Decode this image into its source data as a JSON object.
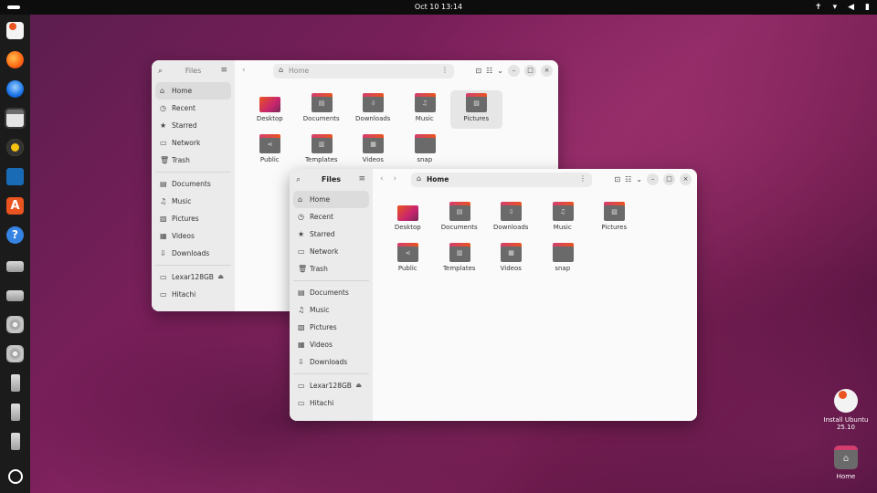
{
  "topbar": {
    "clock": "Oct 10  13:14",
    "status_icons": [
      "accessibility-icon",
      "network-icon",
      "volume-icon",
      "battery-icon"
    ]
  },
  "dock": {
    "items": [
      {
        "name": "installer",
        "icon": "ubuntu-installer-icon"
      },
      {
        "name": "firefox",
        "icon": "firefox-icon"
      },
      {
        "name": "thunderbird",
        "icon": "thunderbird-icon"
      },
      {
        "name": "files",
        "icon": "files-icon",
        "active": true
      },
      {
        "name": "rhythmbox",
        "icon": "rhythmbox-icon"
      },
      {
        "name": "writer",
        "icon": "libreoffice-writer-icon"
      },
      {
        "name": "app-center",
        "icon": "app-center-icon"
      },
      {
        "name": "help",
        "icon": "help-icon"
      },
      {
        "name": "drive-1",
        "icon": "drive-icon"
      },
      {
        "name": "drive-2",
        "icon": "drive-icon"
      },
      {
        "name": "disc-1",
        "icon": "disc-icon"
      },
      {
        "name": "disc-2",
        "icon": "disc-icon"
      },
      {
        "name": "usb-1",
        "icon": "usb-icon"
      },
      {
        "name": "usb-2",
        "icon": "usb-icon"
      },
      {
        "name": "usb-3",
        "icon": "usb-icon"
      },
      {
        "name": "show-apps",
        "icon": "ubuntu-logo-icon"
      }
    ]
  },
  "files_window": {
    "title": "Files",
    "path_label": "Home",
    "sidebar": {
      "places": [
        {
          "label": "Home",
          "icon": "⌂"
        },
        {
          "label": "Recent",
          "icon": "◷"
        },
        {
          "label": "Starred",
          "icon": "★"
        },
        {
          "label": "Network",
          "icon": "▭"
        },
        {
          "label": "Trash",
          "icon": "🗑"
        }
      ],
      "bookmarks": [
        {
          "label": "Documents",
          "icon": "▤"
        },
        {
          "label": "Music",
          "icon": "♫"
        },
        {
          "label": "Pictures",
          "icon": "▧"
        },
        {
          "label": "Videos",
          "icon": "▦"
        },
        {
          "label": "Downloads",
          "icon": "⇩"
        }
      ],
      "devices": [
        {
          "label": "Lexar128GB",
          "icon": "▭",
          "eject": "⏏"
        },
        {
          "label": "Hitachi",
          "icon": "▭"
        }
      ]
    },
    "folders": [
      {
        "label": "Desktop",
        "glyph": ""
      },
      {
        "label": "Documents",
        "glyph": "▤"
      },
      {
        "label": "Downloads",
        "glyph": "⇩"
      },
      {
        "label": "Music",
        "glyph": "♫"
      },
      {
        "label": "Pictures",
        "glyph": "▧"
      },
      {
        "label": "Public",
        "glyph": "⋖"
      },
      {
        "label": "Templates",
        "glyph": "▥"
      },
      {
        "label": "Videos",
        "glyph": "▦"
      },
      {
        "label": "snap",
        "glyph": ""
      }
    ]
  },
  "desktop": {
    "installer_label": "Install Ubuntu 25.10",
    "home_label": "Home"
  }
}
